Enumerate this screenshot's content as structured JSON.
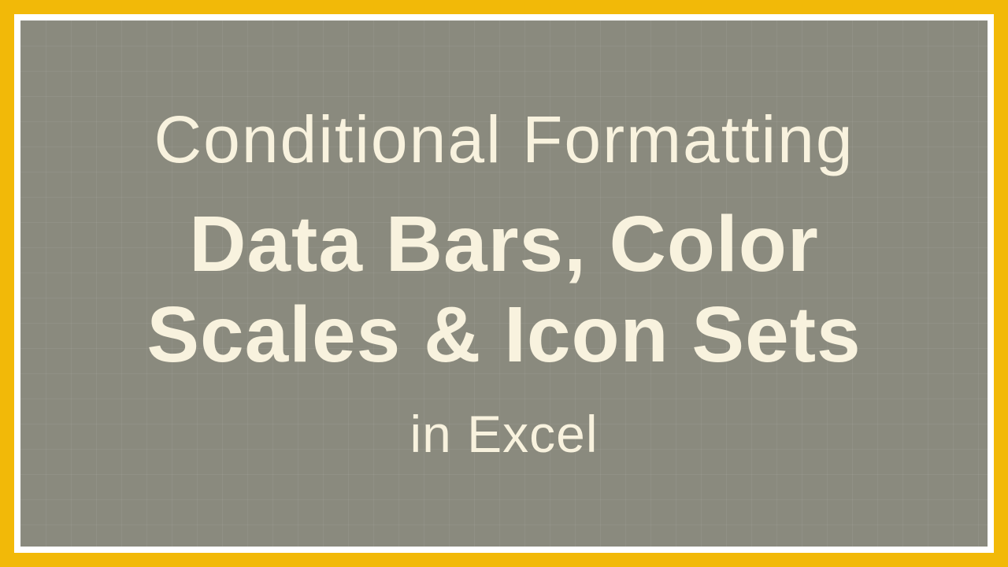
{
  "slide": {
    "title": "Conditional Formatting",
    "subtitle": "Data Bars, Color Scales & Icon Sets",
    "footer": "in Excel"
  }
}
